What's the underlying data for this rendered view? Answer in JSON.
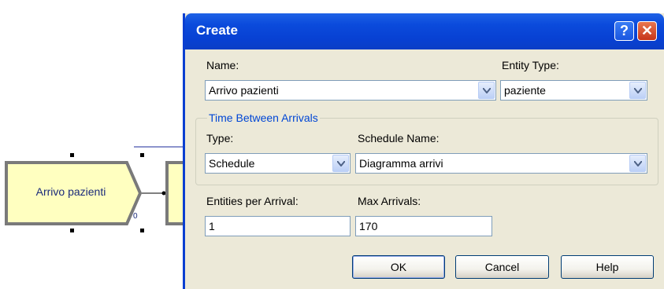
{
  "canvas": {
    "module_label": "Arrivo pazienti",
    "module_counter": "0"
  },
  "dialog": {
    "title": "Create",
    "help_glyph": "?",
    "close_glyph": "✕",
    "name_label": "Name:",
    "name_value": "Arrivo pazienti",
    "entity_type_label": "Entity Type:",
    "entity_type_value": "paziente",
    "group_title": "Time Between Arrivals",
    "type_label": "Type:",
    "type_value": "Schedule",
    "schedule_name_label": "Schedule Name:",
    "schedule_name_value": "Diagramma arrivi",
    "entities_per_arrival_label": "Entities per Arrival:",
    "entities_per_arrival_value": "1",
    "max_arrivals_label": "Max Arrivals:",
    "max_arrivals_value": "170",
    "ok_label": "OK",
    "cancel_label": "Cancel",
    "help_label": "Help"
  },
  "colors": {
    "titlebar": "#0a46d6",
    "dialog_bg": "#ece9d8",
    "module_fill": "#ffffc0",
    "group_title": "#0046d5"
  },
  "icons": [
    "help-icon",
    "close-icon",
    "dropdown-arrow-icon"
  ]
}
